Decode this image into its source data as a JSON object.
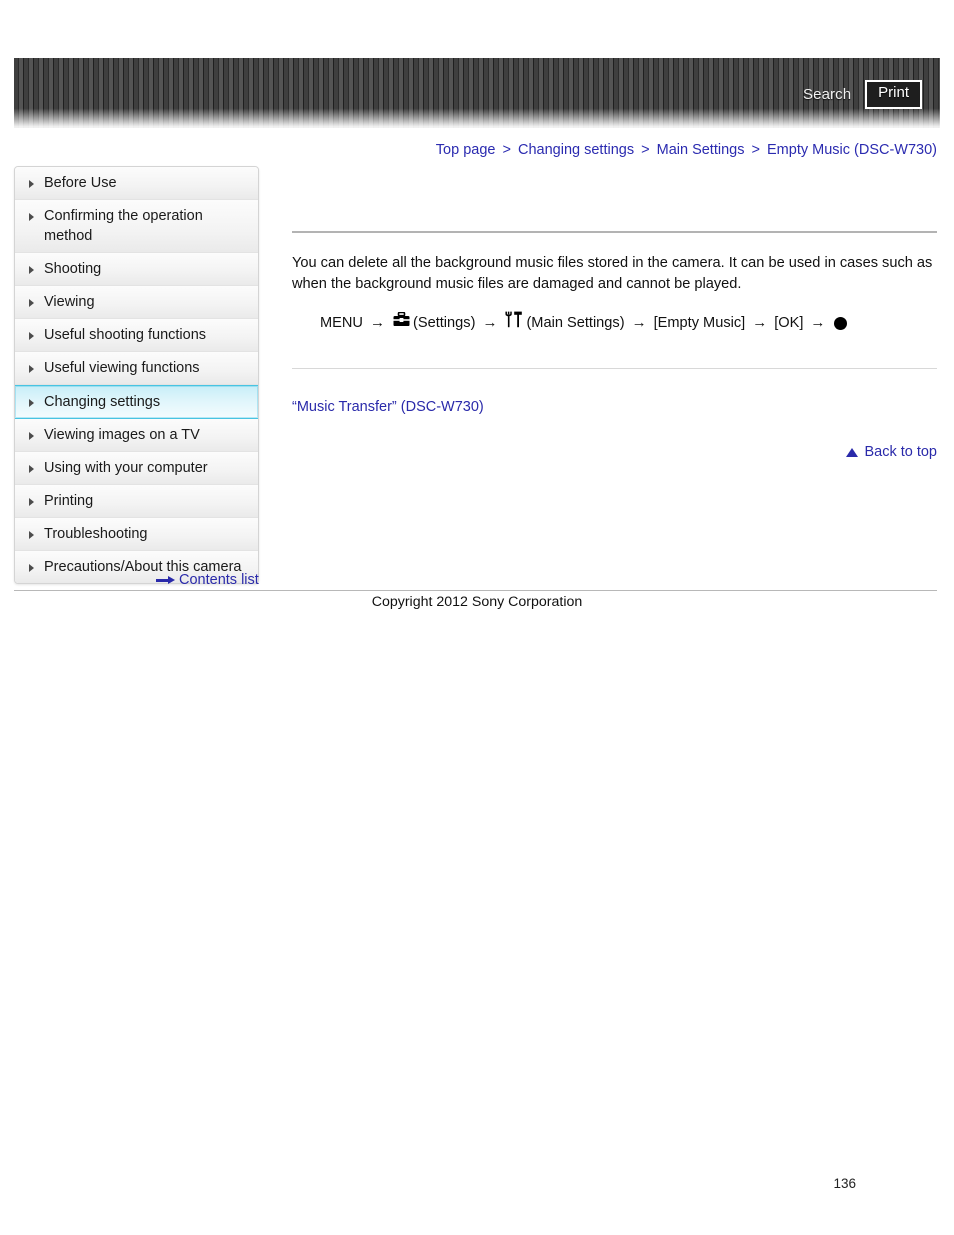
{
  "header": {
    "search_label": "Search",
    "print_label": "Print",
    "search_icon": "search-icon",
    "print_icon": "printer-icon"
  },
  "breadcrumb": {
    "separator": ">",
    "items": [
      {
        "label": "Top page"
      },
      {
        "label": "Changing settings"
      },
      {
        "label": "Main Settings"
      },
      {
        "label": "Empty Music (DSC-W730)"
      }
    ]
  },
  "sidebar": {
    "items": [
      {
        "label": "Before Use",
        "active": false
      },
      {
        "label": "Confirming the operation method",
        "active": false
      },
      {
        "label": "Shooting",
        "active": false
      },
      {
        "label": "Viewing",
        "active": false
      },
      {
        "label": "Useful shooting functions",
        "active": false
      },
      {
        "label": "Useful viewing functions",
        "active": false
      },
      {
        "label": "Changing settings",
        "active": true
      },
      {
        "label": "Viewing images on a TV",
        "active": false
      },
      {
        "label": "Using with your computer",
        "active": false
      },
      {
        "label": "Printing",
        "active": false
      },
      {
        "label": "Troubleshooting",
        "active": false
      },
      {
        "label": "Precautions/About this camera",
        "active": false
      }
    ],
    "contents_list_label": "Contents list",
    "contents_list_icon": "arrow-right-icon"
  },
  "main": {
    "body_paragraph": "You can delete all the background music files stored in the camera. It can be used in cases such as when the background music files are damaged and cannot be played.",
    "menu_path": {
      "start_label": "MENU",
      "arrow": "→",
      "settings_icon": "toolbox-icon",
      "settings_label": "(Settings)",
      "main_settings_icon": "fork-knife-icon",
      "main_settings_label": "(Main Settings)",
      "item_label": "[Empty Music]",
      "confirm_label": "[OK]",
      "end_icon": "record-dot-icon"
    },
    "related_link_label": "“Music Transfer” (DSC-W730)",
    "back_to_top_label": "Back to top",
    "back_to_top_icon": "triangle-up-icon"
  },
  "footer": {
    "copyright": "Copyright 2012 Sony Corporation",
    "page_number": "136"
  },
  "colors": {
    "link": "#2a2aaa",
    "active_nav_border": "#48c4e2",
    "header_dark": "#3f3f3f"
  }
}
